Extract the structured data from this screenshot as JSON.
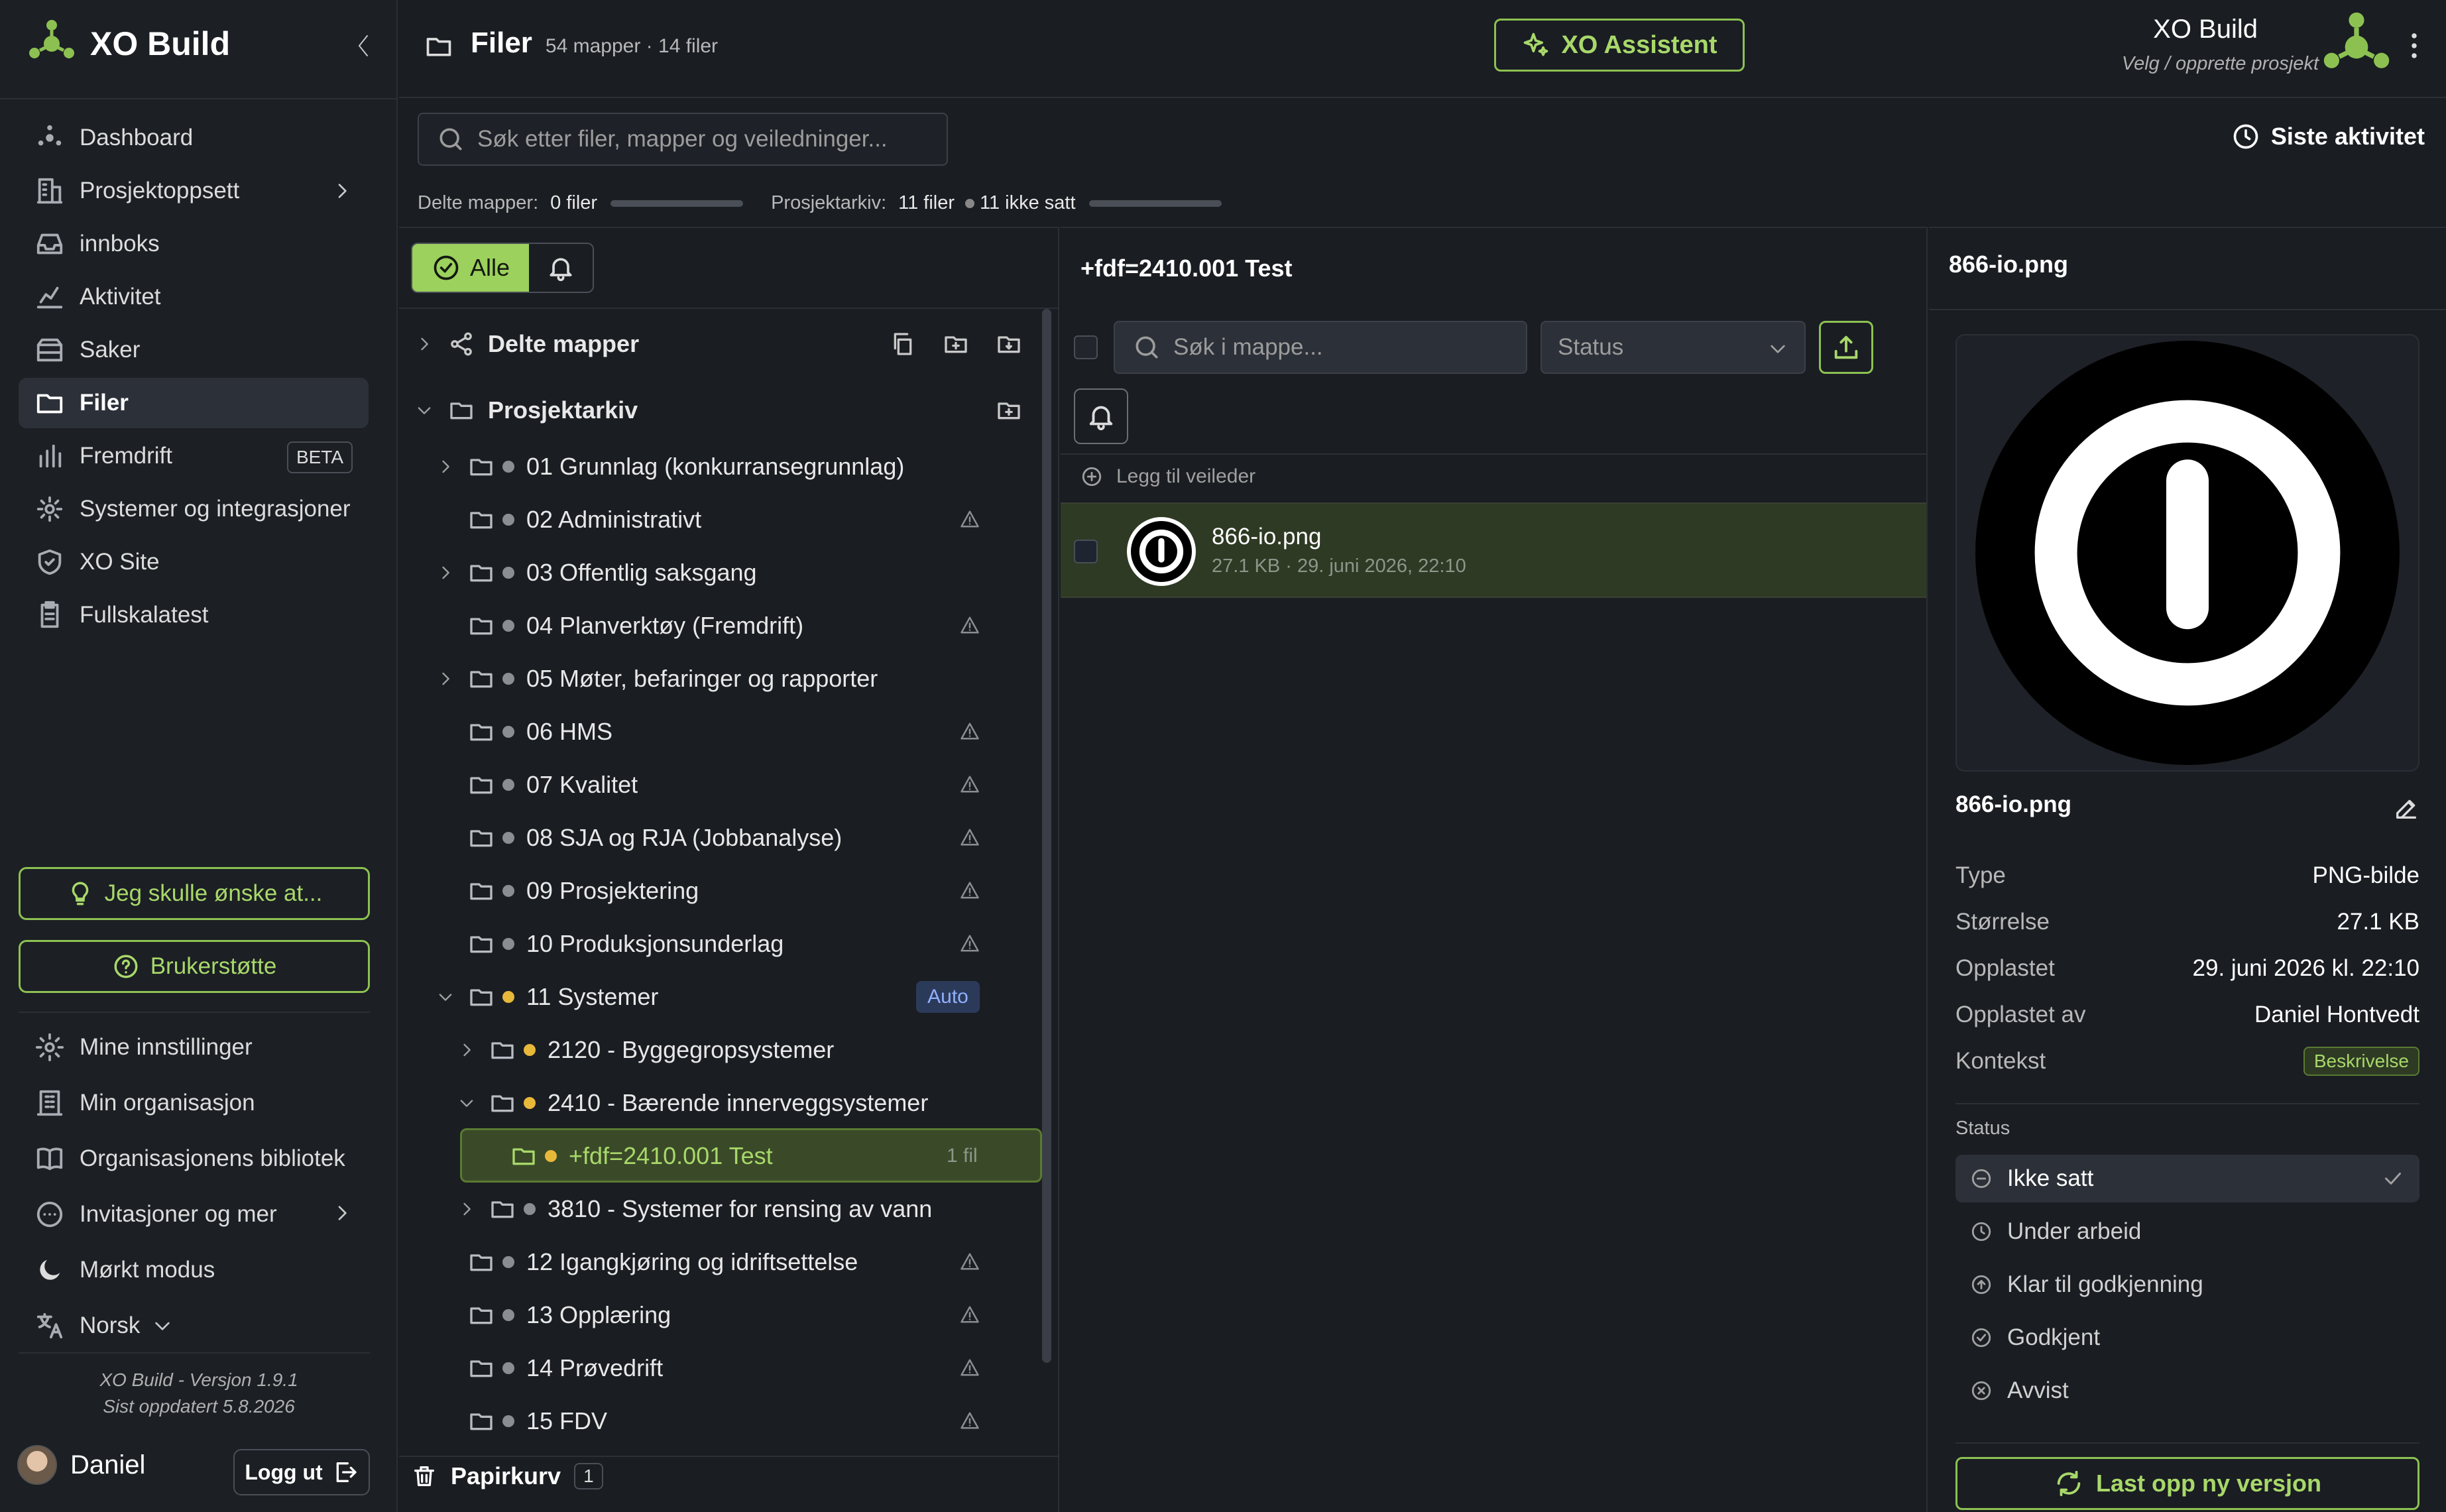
{
  "brand": {
    "name": "XO Build",
    "accent": "#8cc152"
  },
  "sidebar": {
    "nav": [
      {
        "label": "Dashboard",
        "icon": "dashboard-icon"
      },
      {
        "label": "Prosjektoppsett",
        "icon": "building-icon"
      },
      {
        "label": "innboks",
        "icon": "inbox-icon"
      },
      {
        "label": "Aktivitet",
        "icon": "activity-icon"
      },
      {
        "label": "Saker",
        "icon": "cases-icon"
      },
      {
        "label": "Filer",
        "icon": "folder-icon",
        "active": true
      },
      {
        "label": "Fremdrift",
        "icon": "bar-chart-icon",
        "badge": "BETA"
      },
      {
        "label": "Systemer og integrasjoner",
        "icon": "integrations-icon"
      },
      {
        "label": "XO Site",
        "icon": "shield-icon"
      },
      {
        "label": "Fullskalatest",
        "icon": "clipboard-icon"
      }
    ],
    "wish_button": "Jeg skulle ønske at...",
    "support_button": "Brukerstøtte",
    "nav2": [
      {
        "label": "Mine innstillinger",
        "icon": "settings-icon"
      },
      {
        "label": "Min organisasjon",
        "icon": "organization-icon"
      },
      {
        "label": "Organisasjonens bibliotek",
        "icon": "book-icon"
      },
      {
        "label": "Invitasjoner og mer",
        "icon": "more-circle-icon"
      },
      {
        "label": "Mørkt modus",
        "icon": "moon-icon"
      },
      {
        "label": "Norsk",
        "icon": "language-icon"
      }
    ],
    "version": "XO Build - Versjon 1.9.1",
    "updated": "Sist oppdatert 5.8.2026",
    "user": "Daniel",
    "logout": "Logg ut"
  },
  "header": {
    "title": "Filer",
    "subtitle": "54 mapper · 14 filer",
    "assistant_button": "XO Assistent",
    "project_name": "XO Build",
    "project_sub": "Velg / opprette prosjekt"
  },
  "search": {
    "placeholder": "Søk etter filer, mapper og veiledninger..."
  },
  "activity_button": "Siste aktivitet",
  "stats": {
    "shared_label": "Delte mapper:",
    "shared_value": "0 filer",
    "archive_label": "Prosjektarkiv:",
    "archive_value": "11 filer",
    "archive_unset": "11 ikke satt"
  },
  "folders": {
    "filter_all": "Alle",
    "shared_root": "Delte mapper",
    "archive_root": "Prosjektarkiv",
    "items": [
      {
        "label": "01 Grunnlag (konkurransegrunnlag)"
      },
      {
        "label": "02 Administrativt"
      },
      {
        "label": "03 Offentlig saksgang"
      },
      {
        "label": "04 Planverktøy (Fremdrift)"
      },
      {
        "label": "05 Møter, befaringer og rapporter"
      },
      {
        "label": "06 HMS"
      },
      {
        "label": "07 Kvalitet"
      },
      {
        "label": "08 SJA og RJA (Jobbanalyse)"
      },
      {
        "label": "09 Prosjektering"
      },
      {
        "label": "10 Produksjonsunderlag"
      },
      {
        "label": "11 Systemer",
        "badge": "Auto"
      },
      {
        "label": "2120 - Byggegropsystemer"
      },
      {
        "label": "2410 - Bærende innerveggsystemer"
      },
      {
        "label": "+fdf=2410.001 Test",
        "count": "1 fil"
      },
      {
        "label": "3810 - Systemer for rensing av vann"
      },
      {
        "label": "12 Igangkjøring og idriftsettelse"
      },
      {
        "label": "13 Opplæring"
      },
      {
        "label": "14 Prøvedrift"
      },
      {
        "label": "15 FDV"
      }
    ],
    "trash_label": "Papirkurv",
    "trash_count": "1"
  },
  "center": {
    "title": "+fdf=2410.001 Test",
    "search_placeholder": "Søk i mappe...",
    "status_placeholder": "Status",
    "add_guide": "Legg til veileder",
    "file": {
      "name": "866-io.png",
      "meta": "27.1 KB · 29. juni 2026, 22:10"
    }
  },
  "details": {
    "header": "866-io.png",
    "file_name": "866-io.png",
    "rows": [
      {
        "key": "Type",
        "value": "PNG-bilde"
      },
      {
        "key": "Størrelse",
        "value": "27.1 KB"
      },
      {
        "key": "Opplastet",
        "value": "29. juni 2026 kl. 22:10"
      },
      {
        "key": "Opplastet av",
        "value": "Daniel Hontvedt"
      },
      {
        "key": "Kontekst",
        "value": "Beskrivelse"
      }
    ],
    "status_label": "Status",
    "statuses": [
      {
        "label": "Ikke satt",
        "selected": true
      },
      {
        "label": "Under arbeid"
      },
      {
        "label": "Klar til godkjenning"
      },
      {
        "label": "Godkjent"
      },
      {
        "label": "Avvist"
      }
    ],
    "upload_new_version": "Last opp ny versjon"
  }
}
